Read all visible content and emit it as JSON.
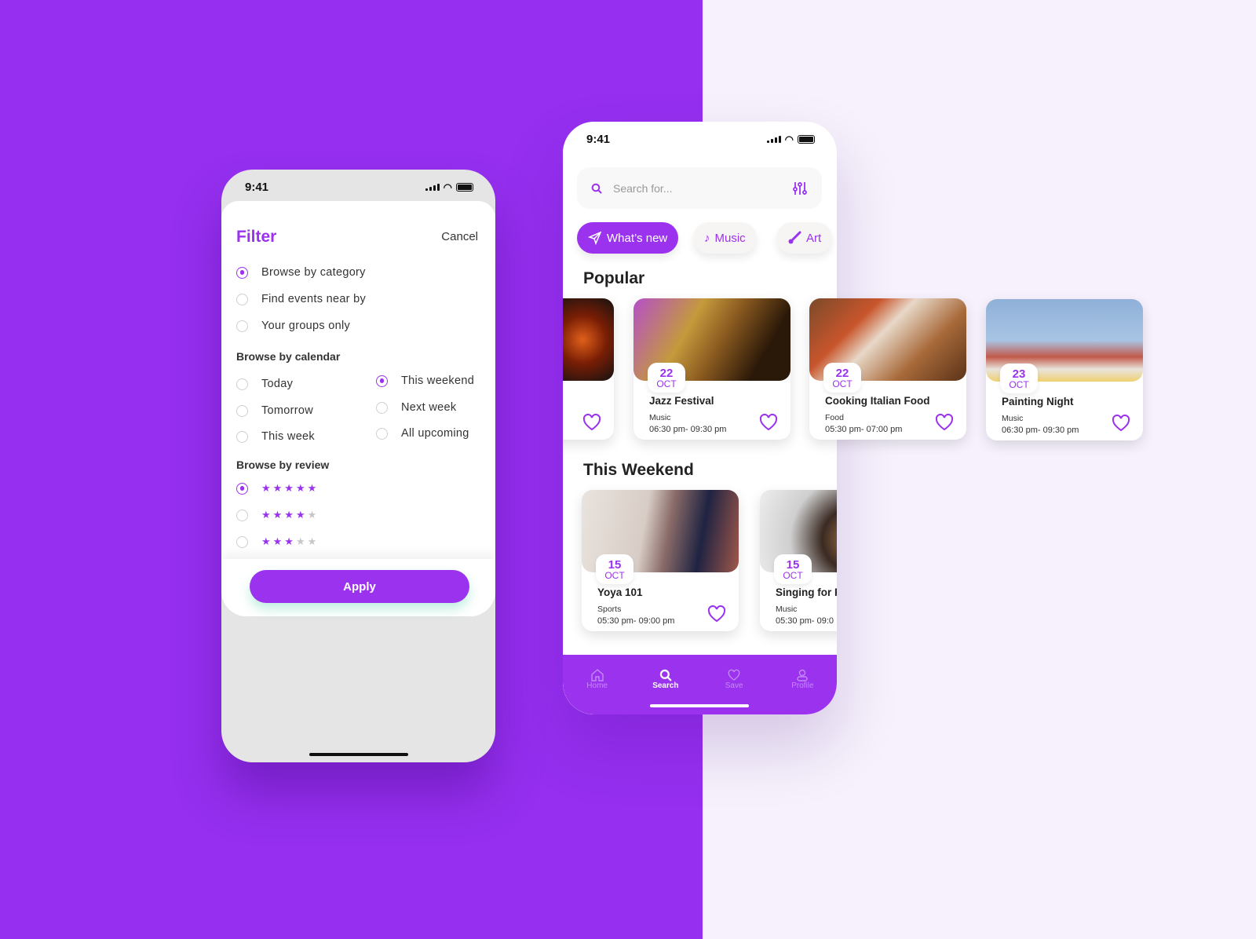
{
  "colors": {
    "accent": "#9a32ee",
    "bg_left": "#962ff0",
    "bg_right": "#f6f1fc"
  },
  "filter_screen": {
    "status_time": "9:41",
    "title": "Filter",
    "cancel_label": "Cancel",
    "browse_options": [
      {
        "label": "Browse by category",
        "selected": true
      },
      {
        "label": "Find events near by",
        "selected": false
      },
      {
        "label": "Your groups only",
        "selected": false
      }
    ],
    "calendar_heading": "Browse by calendar",
    "calendar_options": [
      {
        "label": "Today",
        "selected": false
      },
      {
        "label": "Tomorrow",
        "selected": false
      },
      {
        "label": "This week",
        "selected": false
      },
      {
        "label": "This weekend",
        "selected": true
      },
      {
        "label": "Next week",
        "selected": false
      },
      {
        "label": "All upcoming",
        "selected": false
      }
    ],
    "review_heading": "Browse by review",
    "review_options": [
      {
        "stars": 5,
        "selected": true
      },
      {
        "stars": 4,
        "selected": false
      },
      {
        "stars": 3,
        "selected": false
      }
    ],
    "apply_label": "Apply"
  },
  "search_screen": {
    "status_time": "9:41",
    "search_placeholder": "Search for...",
    "chips": [
      {
        "label": "What’s new",
        "icon": "send-icon",
        "active": true
      },
      {
        "label": "Music",
        "icon": "music-note-icon",
        "active": false
      },
      {
        "label": "Art",
        "icon": "brush-icon",
        "active": false
      }
    ],
    "popular_heading": "Popular",
    "popular": [
      {
        "title": "Jazz Festival",
        "category": "Music",
        "time": "06:30 pm- 09:30 pm",
        "day": "22",
        "month": "OCT"
      },
      {
        "title": "Cooking Italian Food",
        "category": "Food",
        "time": "05:30 pm- 07:00 pm",
        "day": "22",
        "month": "OCT"
      },
      {
        "title": "Painting Night",
        "category": "Music",
        "time": "06:30 pm- 09:30 pm",
        "day": "23",
        "month": "OCT"
      }
    ],
    "weekend_heading": "This Weekend",
    "weekend": [
      {
        "title": "Yoya 101",
        "category": "Sports",
        "time": "05:30 pm- 09:00 pm",
        "day": "15",
        "month": "OCT"
      },
      {
        "title": "Singing for F",
        "category": "Music",
        "time": "05:30 pm- 09:0",
        "day": "15",
        "month": "OCT"
      }
    ],
    "nav": [
      {
        "label": "Home",
        "icon": "home-icon",
        "active": false
      },
      {
        "label": "Search",
        "icon": "search-icon",
        "active": true
      },
      {
        "label": "Save",
        "icon": "heart-icon",
        "active": false
      },
      {
        "label": "Profile",
        "icon": "user-icon",
        "active": false
      }
    ]
  }
}
